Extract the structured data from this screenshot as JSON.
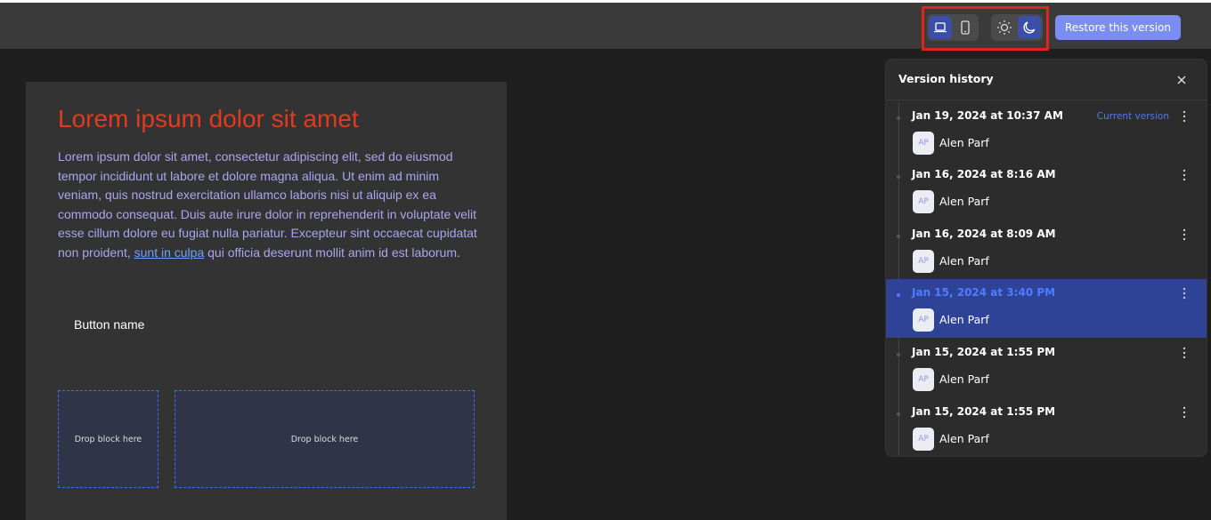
{
  "toolbar": {
    "device_icons": [
      "laptop-icon",
      "mobile-icon"
    ],
    "theme_icons": [
      "sun-icon",
      "moon-icon"
    ],
    "restore_label": "Restore this version",
    "accent": "#7b8df0"
  },
  "content": {
    "headline": "Lorem ipsum dolor sit amet",
    "body_before": "Lorem ipsum dolor sit amet, consectetur adipiscing elit, sed do eiusmod tempor incididunt ut labore et dolore magna aliqua. Ut enim ad minim veniam, quis nostrud exercitation ullamco laboris nisi ut aliquip ex ea commodo consequat. Duis aute irure dolor in reprehenderit in voluptate velit esse cillum dolore eu fugiat nulla pariatur. Excepteur sint occaecat cupidatat non proident, ",
    "body_link": "sunt in culpa",
    "body_after": " qui officia deserunt mollit anim id est laborum.",
    "button_name": "Button name",
    "drop_label_1": "Drop block here",
    "drop_label_2": "Drop block here"
  },
  "history": {
    "title": "Version history",
    "current_label": "Current version",
    "entries": [
      {
        "date": "Jan 19, 2024 at 10:37 AM",
        "initials": "AP",
        "user": "Alen Parf"
      },
      {
        "date": "Jan 16, 2024 at 8:16 AM",
        "initials": "AP",
        "user": "Alen Parf"
      },
      {
        "date": "Jan 16, 2024 at 8:09 AM",
        "initials": "AP",
        "user": "Alen Parf"
      },
      {
        "date": "Jan 15, 2024 at 3:40 PM",
        "initials": "AP",
        "user": "Alen Parf"
      },
      {
        "date": "Jan 15, 2024 at 1:55 PM",
        "initials": "AP",
        "user": "Alen Parf"
      },
      {
        "date": "Jan 15, 2024 at 1:55 PM",
        "initials": "AP",
        "user": "Alen Parf"
      }
    ]
  }
}
